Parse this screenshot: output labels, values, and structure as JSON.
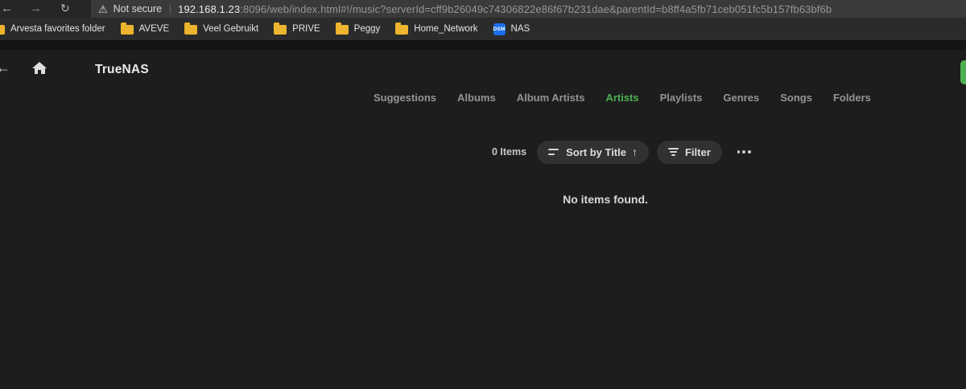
{
  "icons": {
    "back": "←",
    "forward": "→",
    "refresh": "↻",
    "warning": "⚠",
    "sort_direction": "↑"
  },
  "browser": {
    "security_warning": "Not secure",
    "url_host": "192.168.1.23",
    "url_rest": ":8096/web/index.html#!/music?serverId=cff9b26049c74306822e86f67b231dae&parentId=b8ff4a5fb71ceb051fc5b157fb63bf6b",
    "bookmarks": [
      {
        "label": "Arvesta favorites folder",
        "icon": "folder"
      },
      {
        "label": "AVEVE",
        "icon": "folder"
      },
      {
        "label": "Veel Gebruikt",
        "icon": "folder"
      },
      {
        "label": "PRIVE",
        "icon": "folder"
      },
      {
        "label": "Peggy",
        "icon": "folder"
      },
      {
        "label": "Home_Network",
        "icon": "folder"
      },
      {
        "label": "NAS",
        "icon": "dsm"
      }
    ],
    "dsm_icon_text": "DSM"
  },
  "app": {
    "title": "TrueNAS",
    "tabs": [
      {
        "label": "Suggestions",
        "active": false
      },
      {
        "label": "Albums",
        "active": false
      },
      {
        "label": "Album Artists",
        "active": false
      },
      {
        "label": "Artists",
        "active": true
      },
      {
        "label": "Playlists",
        "active": false
      },
      {
        "label": "Genres",
        "active": false
      },
      {
        "label": "Songs",
        "active": false
      },
      {
        "label": "Folders",
        "active": false
      }
    ],
    "toolbar": {
      "items_count": "0 Items",
      "sort_label": "Sort by Title",
      "filter_label": "Filter"
    },
    "empty_message": "No items found.",
    "colors": {
      "accent_green": "#4caf50",
      "folder_yellow": "#edb42d",
      "dsm_blue": "#1a6ee8"
    }
  }
}
